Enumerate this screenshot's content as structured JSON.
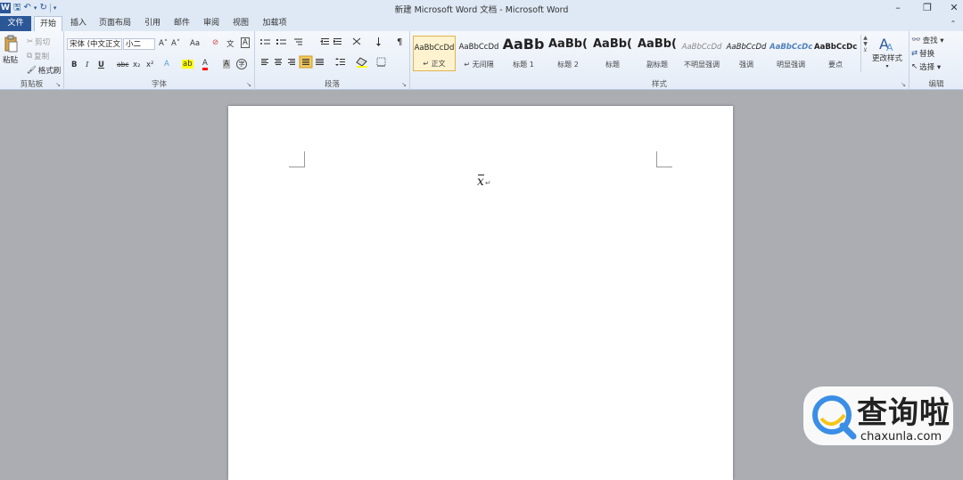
{
  "window": {
    "title": "新建 Microsoft Word 文档 - Microsoft Word",
    "app_icon": "W",
    "controls": {
      "minimize": "–",
      "restore": "❐",
      "close": "✕"
    }
  },
  "qat": {
    "save": "🖫",
    "undo": "↶",
    "undo_drop": "▾",
    "redo": "↻",
    "more": "▾"
  },
  "tabs": [
    "文件",
    "开始",
    "插入",
    "页面布局",
    "引用",
    "邮件",
    "审阅",
    "视图",
    "加载项"
  ],
  "ribbon_collapse": "⌃",
  "clipboard": {
    "paste": "粘贴",
    "cut": "剪切",
    "copy": "复制",
    "format_painter": "格式刷",
    "label": "剪贴板"
  },
  "font": {
    "name": "宋体 (中文正文",
    "size": "小二",
    "grow": "A˄",
    "shrink": "A˅",
    "change_case": "Aa",
    "clear": "⊘",
    "phonetic": "文",
    "border": "A",
    "bold": "B",
    "italic": "I",
    "underline": "U",
    "strike": "abc",
    "subscript": "x₂",
    "superscript": "x²",
    "text_effect": "A",
    "highlight": "ab",
    "font_color": "A",
    "shading": "A",
    "enclose": "字",
    "label": "字体"
  },
  "paragraph": {
    "label": "段落"
  },
  "styles": {
    "label": "样式",
    "items": [
      {
        "sample": "AaBbCcDd",
        "name": "↵ 正文"
      },
      {
        "sample": "AaBbCcDd",
        "name": "↵ 无间隔"
      },
      {
        "sample": "AaBb",
        "name": "标题 1"
      },
      {
        "sample": "AaBb(",
        "name": "标题 2"
      },
      {
        "sample": "AaBb(",
        "name": "标题"
      },
      {
        "sample": "AaBb(",
        "name": "副标题"
      },
      {
        "sample": "AaBbCcDd",
        "name": "不明显强调"
      },
      {
        "sample": "AaBbCcDd",
        "name": "强调"
      },
      {
        "sample": "AaBbCcDc",
        "name": "明显强调"
      },
      {
        "sample": "AaBbCcDc",
        "name": "要点"
      }
    ],
    "change_styles": "更改样式"
  },
  "editing": {
    "find": "查找 ▾",
    "replace": "替换",
    "select": "选择 ▾",
    "label": "编辑"
  },
  "document": {
    "formula": "x",
    "paragraph_mark": "↵"
  },
  "watermark": {
    "brand": "查询啦",
    "domain": "chaxunla.com"
  },
  "colors": {
    "file_tab": "#2b5797",
    "highlight": "#ffff00",
    "font_color": "#ff0000",
    "selected_style": "#fff3cf"
  }
}
